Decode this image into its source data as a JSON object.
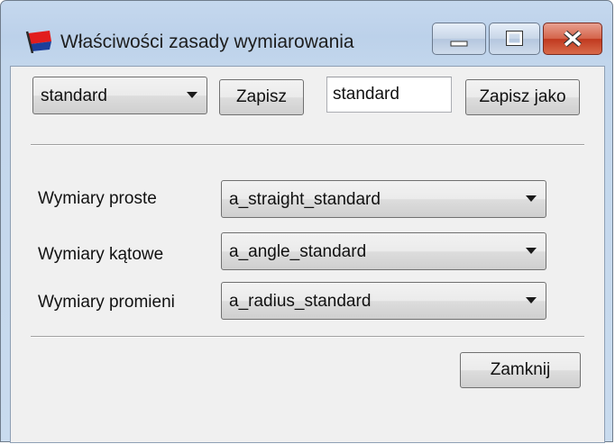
{
  "window": {
    "title": "Właściwości zasady wymiarowania"
  },
  "toolbar": {
    "rule_select_value": "standard",
    "save_label": "Zapisz",
    "name_input_value": "standard",
    "save_as_label": "Zapisz jako"
  },
  "dimensions": {
    "straight": {
      "label": "Wymiary proste",
      "value": "a_straight_standard"
    },
    "angle": {
      "label": "Wymiary kątowe",
      "value": "a_angle_standard"
    },
    "radius": {
      "label": "Wymiary promieni",
      "value": "a_radius_standard"
    }
  },
  "footer": {
    "close_label": "Zamknij"
  },
  "colors": {
    "titlebar": "#bcd1ea",
    "close_button": "#c0391f",
    "client_background": "#f0f0f0"
  }
}
